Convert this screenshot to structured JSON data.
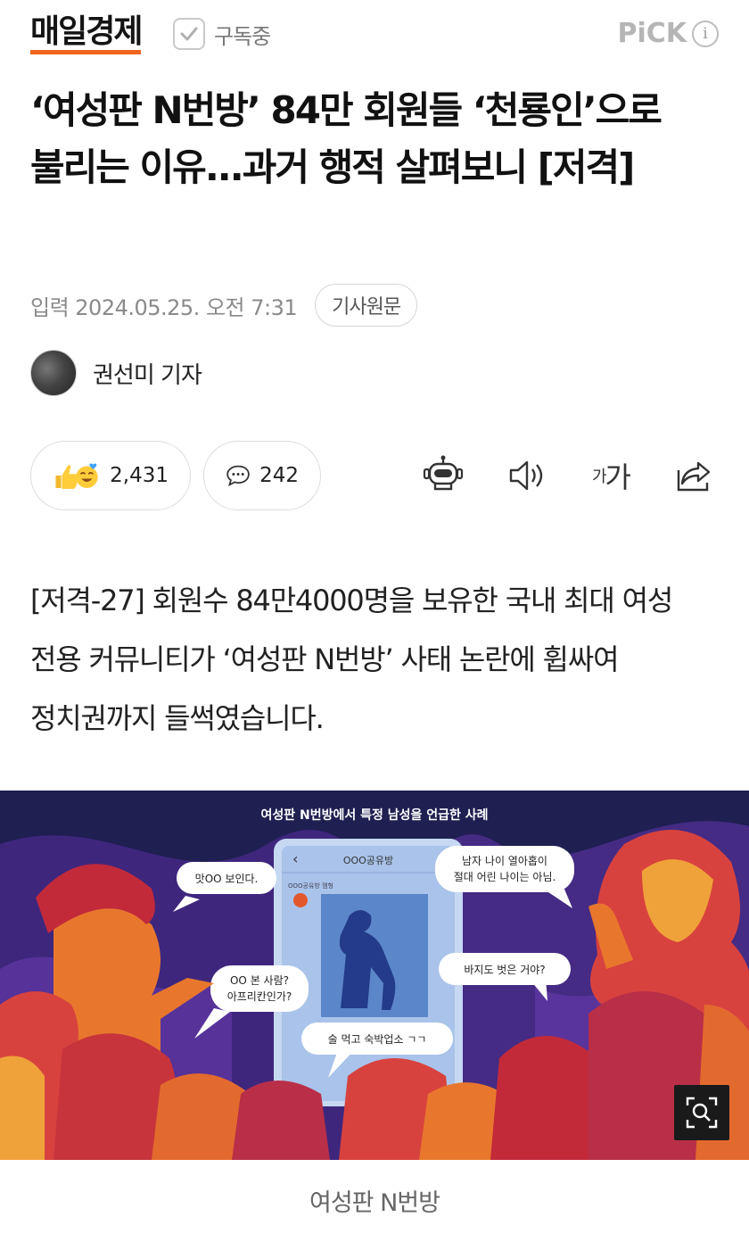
{
  "header": {
    "brand": "매일경제",
    "subscribe_label": "구독중",
    "pick_label": "PiCK",
    "info_glyph": "i"
  },
  "article": {
    "title": "‘여성판 N번방’ 84만 회원들 ‘천룡인’으로 불리는 이유...과거 행적 살펴보니 [저격]",
    "date_text": "입력 2024.05.25. 오전 7:31",
    "origin_button": "기사원문",
    "reporter": "권선미 기자",
    "lead": "[저격-27] 회원수 84만4000명을 보유한 국내 최대 여성 전용 커뮤니티가 ‘여성판 N번방’ 사태 논란에 휩싸여 정치권까지 들썩였습니다.",
    "image_caption": "여성판 N번방"
  },
  "reactions": {
    "like_count": "2,431",
    "comment_count": "242",
    "font_tool_small": "가",
    "font_tool_large": "가"
  },
  "illustration": {
    "heading": "여성판 N번방에서 특정 남성을 언급한 사례",
    "phone_title": "OOO공유방",
    "phone_sub": "OOO공유방 멤형",
    "bubble_1": "맛OO 보인다.",
    "bubble_2a": "남자 나이 열아홉이",
    "bubble_2b": "절대 어린 나이는 아님.",
    "bubble_3a": "OO 본 사람?",
    "bubble_3b": "아프리칸인가?",
    "bubble_4": "바지도 벗은 거야?",
    "bubble_5": "술 먹고 숙박업소 ㄱㄱ"
  },
  "colors": {
    "brand_underline": "#f0641e",
    "illustration_bg": "#1f1f52",
    "phone_screen": "#a9c3ea",
    "figure_blue": "#233b8a"
  },
  "icons": [
    "check-icon",
    "info-icon",
    "thumbs-up-emoji-icon",
    "smile-emoji-icon",
    "comment-bubble-icon",
    "robot-summary-icon",
    "speaker-icon",
    "share-icon",
    "zoom-icon"
  ]
}
